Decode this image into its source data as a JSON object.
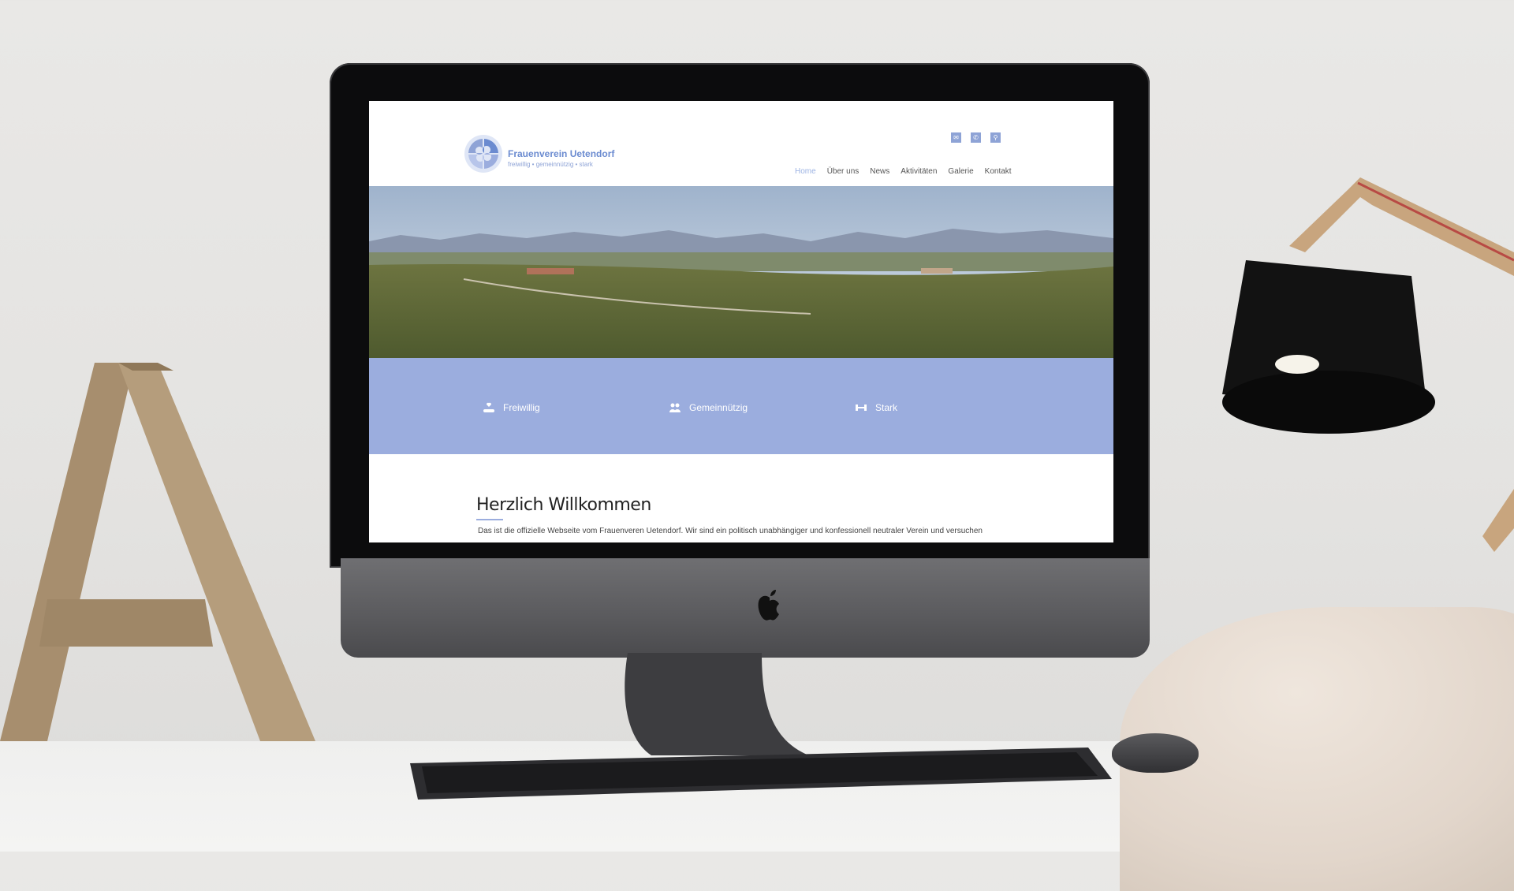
{
  "site": {
    "logo": {
      "name": "Frauenverein Uetendorf",
      "tagline": "freiwillig • gemeinnützig • stark"
    },
    "top_icons": [
      {
        "name": "mail-icon",
        "glyph": "✉"
      },
      {
        "name": "phone-icon",
        "glyph": "✆"
      },
      {
        "name": "search-icon",
        "glyph": "⚲"
      }
    ],
    "nav": {
      "items": [
        "Home",
        "Über uns",
        "News",
        "Aktivitäten",
        "Galerie",
        "Kontakt"
      ],
      "active": "Home"
    },
    "features": [
      {
        "label": "Freiwillig",
        "icon": "hand-heart-icon"
      },
      {
        "label": "Gemeinnützig",
        "icon": "users-icon"
      },
      {
        "label": "Stark",
        "icon": "dumbbell-icon"
      }
    ],
    "content": {
      "title": "Herzlich Willkommen",
      "intro": "Das ist die offizielle Webseite vom Frauenveren Uetendorf. Wir sind ein politisch unabhängiger und konfessionell neutraler Verein und versuchen"
    },
    "colors": {
      "accent": "#9badde",
      "logo": "#6b8bd0"
    }
  }
}
